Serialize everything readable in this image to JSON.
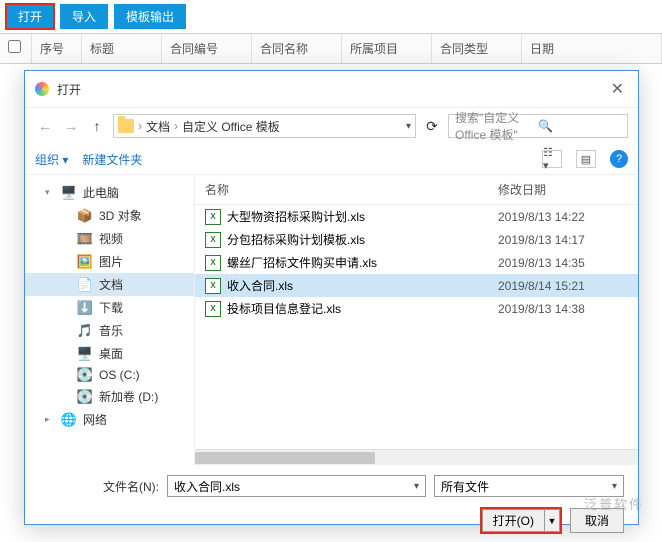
{
  "toolbar": {
    "open": "打开",
    "import": "导入",
    "export": "模板输出"
  },
  "grid": {
    "num": "序号",
    "std": "标题",
    "cno": "合同编号",
    "cname": "合同名称",
    "proj": "所属项目",
    "ctype": "合同类型",
    "date": "日期"
  },
  "dialog": {
    "title": "打开",
    "crumb": {
      "seg1": "文档",
      "seg2": "自定义 Office 模板"
    },
    "search_placeholder": "搜索\"自定义 Office 模板\"",
    "organize": "组织",
    "newfolder": "新建文件夹",
    "tree": [
      {
        "label": "此电脑",
        "icon": "🖥️",
        "lvl": 1,
        "exp": "▾"
      },
      {
        "label": "3D 对象",
        "icon": "📦",
        "lvl": 2
      },
      {
        "label": "视频",
        "icon": "🎞️",
        "lvl": 2
      },
      {
        "label": "图片",
        "icon": "🖼️",
        "lvl": 2
      },
      {
        "label": "文档",
        "icon": "📄",
        "lvl": 2,
        "sel": true
      },
      {
        "label": "下载",
        "icon": "⬇️",
        "lvl": 2
      },
      {
        "label": "音乐",
        "icon": "🎵",
        "lvl": 2
      },
      {
        "label": "桌面",
        "icon": "🖥️",
        "lvl": 2
      },
      {
        "label": "OS (C:)",
        "icon": "💽",
        "lvl": 2
      },
      {
        "label": "新加卷 (D:)",
        "icon": "💽",
        "lvl": 2
      },
      {
        "label": "网络",
        "icon": "🌐",
        "lvl": 1,
        "exp": "▸"
      }
    ],
    "col_name": "名称",
    "col_date": "修改日期",
    "files": [
      {
        "name": "大型物资招标采购计划.xls",
        "date": "2019/8/13 14:22"
      },
      {
        "name": "分包招标采购计划模板.xls",
        "date": "2019/8/13 14:17"
      },
      {
        "name": "螺丝厂招标文件购买申请.xls",
        "date": "2019/8/13 14:35"
      },
      {
        "name": "收入合同.xls",
        "date": "2019/8/14 15:21",
        "sel": true
      },
      {
        "name": "投标项目信息登记.xls",
        "date": "2019/8/13 14:38"
      }
    ],
    "filename_label": "文件名(N):",
    "filename_value": "收入合同.xls",
    "filter": "所有文件",
    "open_btn": "打开(O)",
    "cancel_btn": "取消"
  },
  "watermark": "泛普软件"
}
